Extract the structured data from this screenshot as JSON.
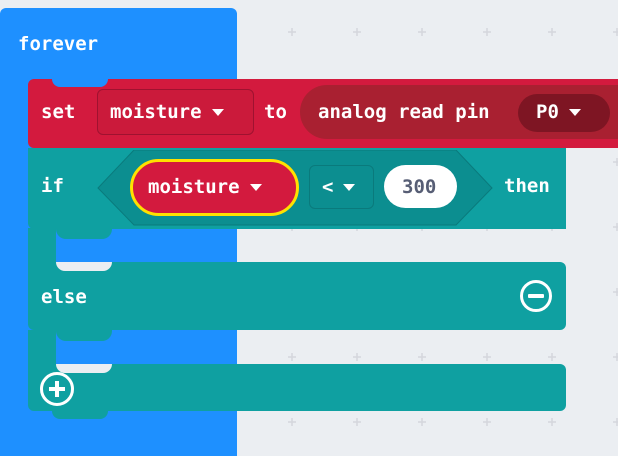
{
  "workspace": {
    "background_color": "#ebeef2"
  },
  "forever_block": {
    "label": "forever",
    "color": "#1e90ff"
  },
  "set_block": {
    "keyword": "set",
    "variable": "moisture",
    "to_keyword": "to",
    "color": "#d31a3e",
    "value_block": {
      "label": "analog read pin",
      "pin": "P0",
      "color": "#a92031"
    }
  },
  "if_block": {
    "if_keyword": "if",
    "then_keyword": "then",
    "else_keyword": "else",
    "color": "#0fa0a1",
    "condition": {
      "left_variable": "moisture",
      "operator": "<",
      "right_value": "300"
    },
    "remove_else_icon": "minus-circle-icon",
    "add_branch_icon": "plus-circle-icon"
  }
}
